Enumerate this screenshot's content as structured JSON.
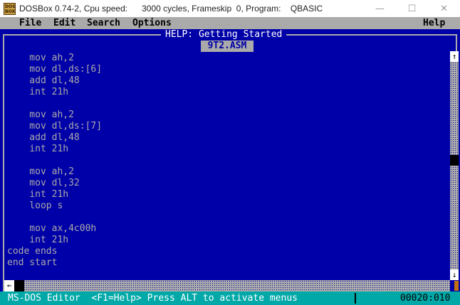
{
  "window": {
    "title": "DOSBox 0.74-2, Cpu speed:      3000 cycles, Frameskip  0, Program:    QBASIC",
    "icon_label_top": "DOS",
    "icon_label_bottom": "BOX",
    "minimize_icon": "minimize-icon",
    "maximize_icon": "maximize-icon",
    "close_icon": "close-icon",
    "minimize_glyph": "—",
    "maximize_glyph": "☐",
    "close_glyph": "✕"
  },
  "menu": {
    "file": "File",
    "edit": "Edit",
    "search": "Search",
    "options": "Options",
    "help": "Help"
  },
  "editor": {
    "help_title": "HELP: Getting Started",
    "file_tab": "9T2.ASM",
    "lines": [
      "    mov ah,2",
      "    mov dl,ds:[6]",
      "    add dl,48",
      "    int 21h",
      "",
      "    mov ah,2",
      "    mov dl,ds:[7]",
      "    add dl,48",
      "    int 21h",
      "",
      "    mov ah,2",
      "    mov dl,32",
      "    int 21h",
      "    loop s",
      "",
      "    mov ax,4c00h",
      "    int 21h",
      "code ends",
      "end start"
    ]
  },
  "scrollbar": {
    "up_arrow": "↑",
    "down_arrow": "↓",
    "left_arrow": "←"
  },
  "status": {
    "text": "MS-DOS Editor  <F1=Help> Press ALT to activate menus",
    "position": "00020:010"
  },
  "colors": {
    "dos_blue": "#0000a8",
    "menu_gray": "#aaaaaa",
    "status_cyan": "#00a8a8"
  }
}
